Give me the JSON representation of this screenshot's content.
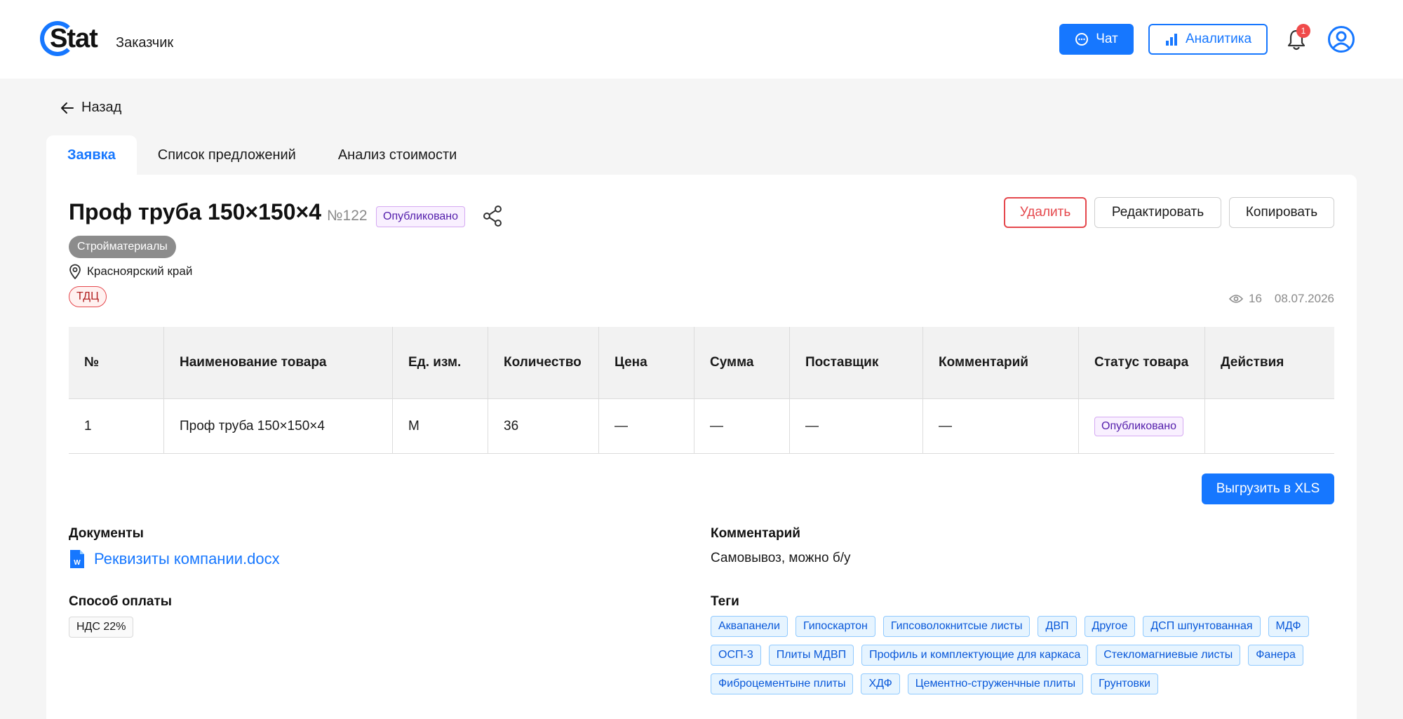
{
  "header": {
    "logo_text": "Stat",
    "role": "Заказчик",
    "chat_label": "Чат",
    "analytics_label": "Аналитика",
    "notifications_count": "1"
  },
  "nav": {
    "back_label": "Назад",
    "tabs": [
      {
        "label": "Заявка",
        "active": true
      },
      {
        "label": "Список предложений",
        "active": false
      },
      {
        "label": "Анализ стоимости",
        "active": false
      }
    ]
  },
  "request": {
    "title": "Проф труба 150×150×4",
    "number": "№122",
    "status": "Опубликовано",
    "category": "Стройматериалы",
    "location": "Красноярский край",
    "badge": "ТДЦ",
    "views": "16",
    "date": "08.07.2026"
  },
  "actions": {
    "delete_label": "Удалить",
    "edit_label": "Редактировать",
    "copy_label": "Копировать",
    "export_label": "Выгрузить в XLS"
  },
  "table": {
    "headers": [
      "№",
      "Наименование товара",
      "Ед. изм.",
      "Количество",
      "Цена",
      "Сумма",
      "Поставщик",
      "Комментарий",
      "Статус товара",
      "Действия"
    ],
    "rows": [
      [
        "1",
        "Проф труба 150×150×4",
        "М",
        "36",
        "—",
        "—",
        "—",
        "—",
        "Опубликовано",
        ""
      ]
    ]
  },
  "documents": {
    "label": "Документы",
    "file_name": "Реквизиты компании.docx"
  },
  "payment": {
    "label": "Способ оплаты",
    "value": "НДС 22%"
  },
  "comment": {
    "label": "Комментарий",
    "text": "Самовывоз, можно б/у"
  },
  "tags": {
    "label": "Теги",
    "items": [
      "Аквапанели",
      "Гипоскартон",
      "Гипсоволокнитсые листы",
      "ДВП",
      "Другое",
      "ДСП шпунтованная",
      "МДФ",
      "ОСП-3",
      "Плиты МДВП",
      "Профиль и комплектующие для каркаса",
      "Стекломагниевые листы",
      "Фанера",
      "Фиброцементыне плиты",
      "ХДФ",
      "Цементно-струженчные плиты",
      "Грунтовки"
    ]
  },
  "colors": {
    "accent": "#1677ff",
    "danger": "#e5484d",
    "status_purple": "#531dab"
  }
}
